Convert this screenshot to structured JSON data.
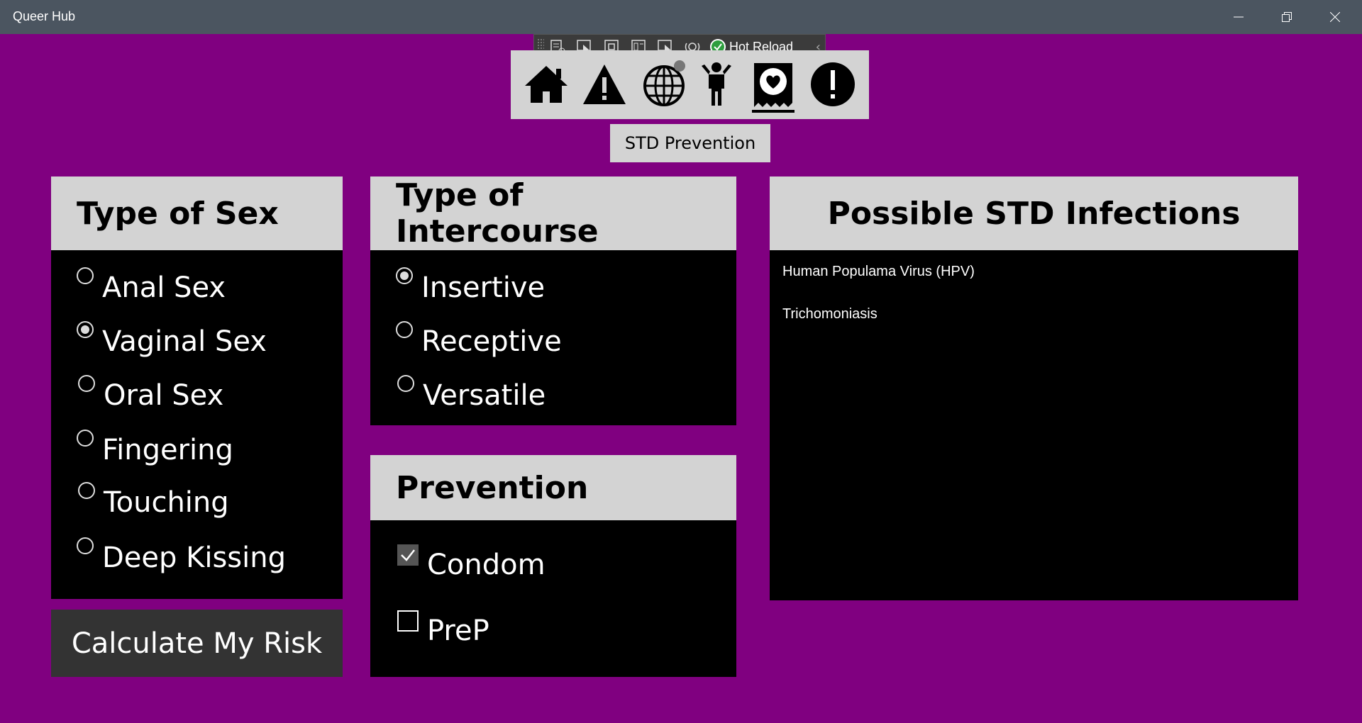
{
  "window": {
    "title": "Queer Hub"
  },
  "toolbar": {
    "hot_reload_label": "Hot Reload"
  },
  "nav": {
    "items": [
      {
        "icon": "home-icon"
      },
      {
        "icon": "warning-icon"
      },
      {
        "icon": "globe-icon"
      },
      {
        "icon": "person-icon"
      },
      {
        "icon": "condom-heart-icon",
        "selected": true
      },
      {
        "icon": "alert-icon"
      }
    ],
    "page_label": "STD Prevention"
  },
  "sex_type": {
    "title": "Type of Sex",
    "options": [
      "Anal Sex",
      "Vaginal Sex",
      "Oral Sex",
      "Fingering",
      "Touching",
      "Deep Kissing"
    ],
    "selected": "Vaginal Sex"
  },
  "intercourse": {
    "title": "Type of Intercourse",
    "options": [
      "Insertive",
      "Receptive",
      "Versatile"
    ],
    "selected": "Insertive"
  },
  "prevention": {
    "title": "Prevention",
    "options": [
      {
        "label": "Condom",
        "checked": true
      },
      {
        "label": "PreP",
        "checked": false
      }
    ]
  },
  "infections": {
    "title": "Possible STD Infections",
    "items": [
      "Human Populama Virus (HPV)",
      "Trichomoniasis"
    ]
  },
  "calculate": {
    "label": "Calculate My Risk"
  },
  "colors": {
    "background": "#800080",
    "panel_head": "#d3d3d3",
    "panel_body": "#000000"
  }
}
